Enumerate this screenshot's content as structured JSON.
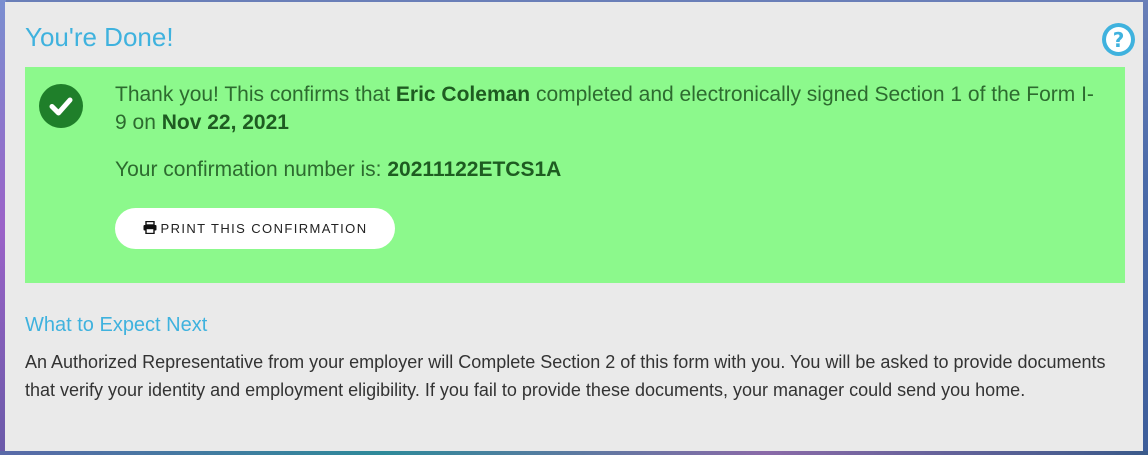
{
  "header": {
    "title": "You're Done!",
    "help_icon": "question-circle-icon",
    "help_glyph": "?"
  },
  "confirmation": {
    "check_icon": "check-circle-icon",
    "message_prefix": "Thank you! This confirms that ",
    "employee_name": "Eric Coleman",
    "message_middle": " completed and electronically signed Section 1 of the Form I-9 on ",
    "signed_date": "Nov 22, 2021",
    "number_label": "Your confirmation number is: ",
    "number": "20211122ETCS1A",
    "print_icon": "print-icon",
    "print_label": "PRINT THIS CONFIRMATION"
  },
  "next": {
    "heading": "What to Expect Next",
    "body": "An Authorized Representative from your employer will Complete Section 2 of this form with you. You will be asked to provide documents that verify your identity and employment eligibility. If you fail to provide these documents, your manager could send you home."
  },
  "colors": {
    "accent": "#3fb2de",
    "success_bg": "#8cf98c",
    "success_text": "#2d6b2f",
    "check_bg": "#1f7f2a",
    "panel_bg": "#eaeaea"
  }
}
